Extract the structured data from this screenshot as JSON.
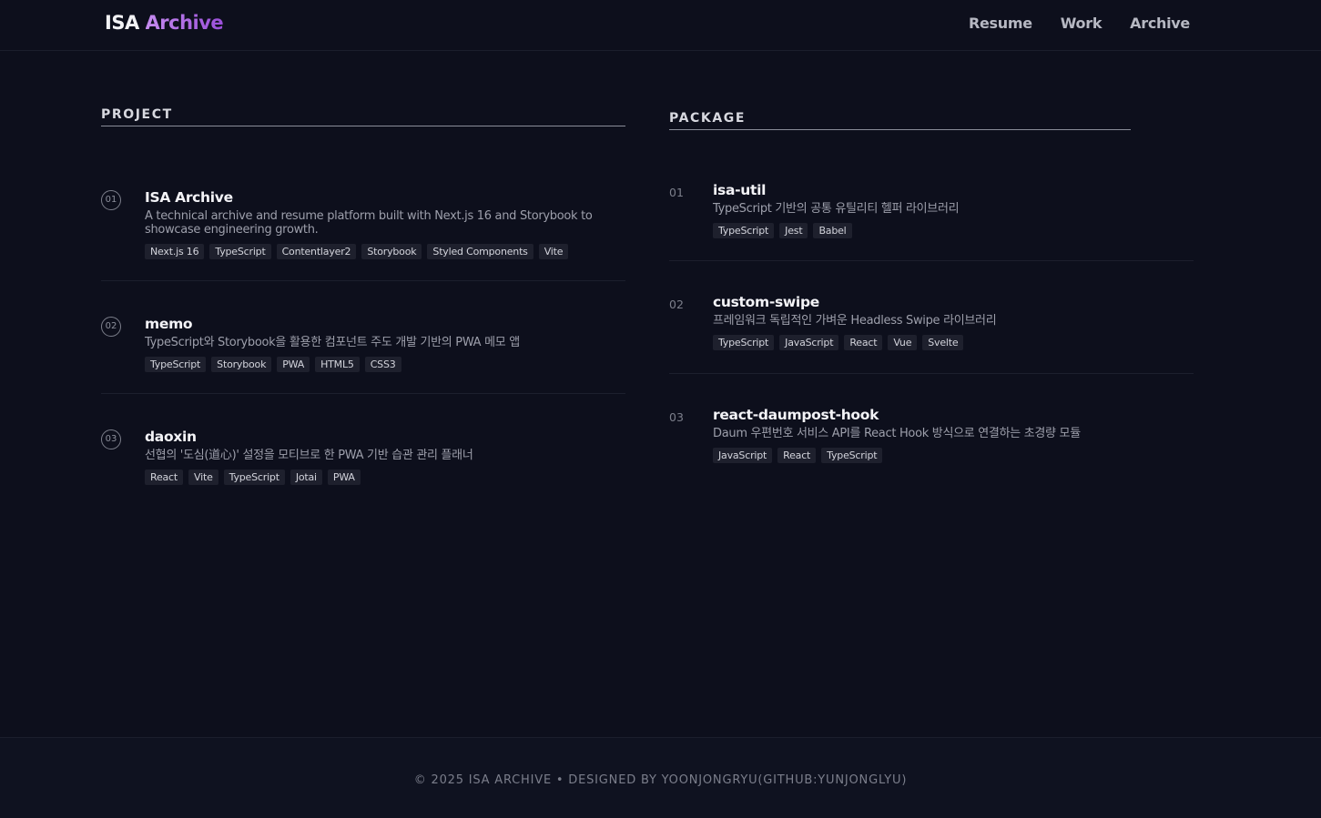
{
  "header": {
    "logo_primary": "ISA",
    "logo_accent": "Archive",
    "nav": [
      "Resume",
      "Work",
      "Archive"
    ]
  },
  "project": {
    "title": "PROJECT",
    "items": [
      {
        "num": "01",
        "title": "ISA Archive",
        "desc": "A technical archive and resume platform built with Next.js 16 and Storybook to showcase engineering growth.",
        "tags": [
          "Next.js 16",
          "TypeScript",
          "Contentlayer2",
          "Storybook",
          "Styled Components",
          "Vite"
        ]
      },
      {
        "num": "02",
        "title": "memo",
        "desc": "TypeScript와 Storybook을 활용한 컴포넌트 주도 개발 기반의 PWA 메모 앱",
        "tags": [
          "TypeScript",
          "Storybook",
          "PWA",
          "HTML5",
          "CSS3"
        ]
      },
      {
        "num": "03",
        "title": "daoxin",
        "desc": "선협의 '도심(道心)' 설정을 모티브로 한 PWA 기반 습관 관리 플래너",
        "tags": [
          "React",
          "Vite",
          "TypeScript",
          "Jotai",
          "PWA"
        ]
      }
    ]
  },
  "package": {
    "title": "PACKAGE",
    "items": [
      {
        "num": "01",
        "title": "isa-util",
        "desc": "TypeScript 기반의 공통 유틸리티 헬퍼 라이브러리",
        "tags": [
          "TypeScript",
          "Jest",
          "Babel"
        ]
      },
      {
        "num": "02",
        "title": "custom-swipe",
        "desc": "프레임워크 독립적인 가벼운 Headless Swipe 라이브러리",
        "tags": [
          "TypeScript",
          "JavaScript",
          "React",
          "Vue",
          "Svelte"
        ]
      },
      {
        "num": "03",
        "title": "react-daumpost-hook",
        "desc": "Daum 우편번호 서비스 API를 React Hook 방식으로 연결하는 초경량 모듈",
        "tags": [
          "JavaScript",
          "React",
          "TypeScript"
        ]
      }
    ]
  },
  "footer": {
    "text": "© 2025 ISA ARCHIVE • DESIGNED BY YOONJONGRYU(GITHUB:YUNJONGLYU)"
  }
}
